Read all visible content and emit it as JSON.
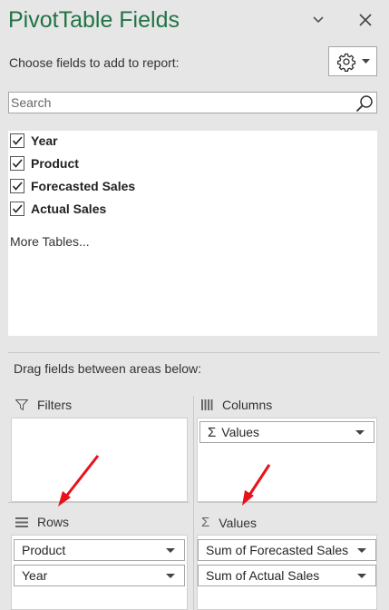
{
  "pane": {
    "title": "PivotTable Fields",
    "subtitle": "Choose fields to add to report:"
  },
  "search": {
    "placeholder": "Search"
  },
  "fields": [
    {
      "label": "Year",
      "checked": true
    },
    {
      "label": "Product",
      "checked": true
    },
    {
      "label": "Forecasted Sales",
      "checked": true
    },
    {
      "label": "Actual Sales",
      "checked": true
    }
  ],
  "more_tables": "More Tables...",
  "drag_label": "Drag fields between areas below:",
  "areas": {
    "filters": {
      "title": "Filters"
    },
    "columns": {
      "title": "Columns",
      "items": [
        "Values"
      ]
    },
    "rows": {
      "title": "Rows",
      "items": [
        "Product",
        "Year"
      ]
    },
    "values": {
      "title": "Values",
      "items": [
        "Sum of Forecasted Sales",
        "Sum of Actual Sales"
      ]
    }
  },
  "colors": {
    "title": "#217346",
    "annotation_arrow": "#e8121a"
  }
}
